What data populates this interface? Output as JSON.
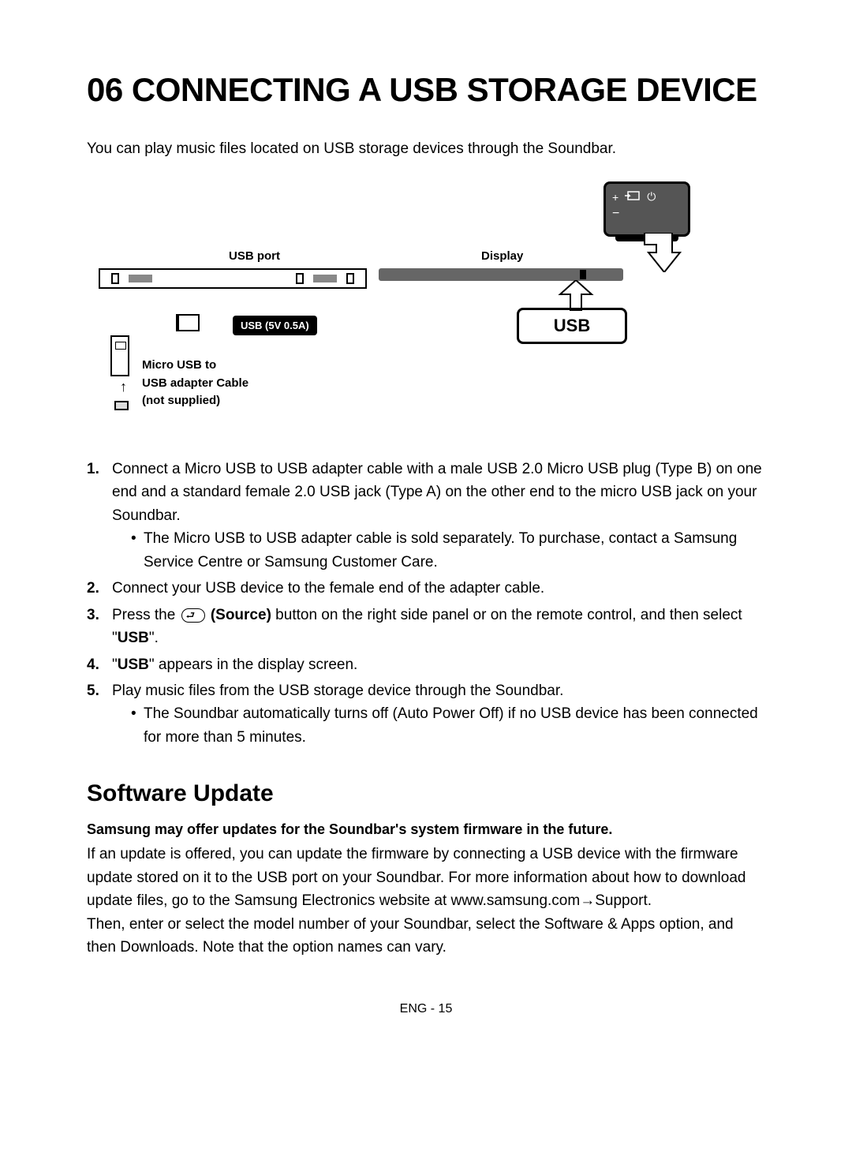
{
  "heading": "06 CONNECTING A USB STORAGE DEVICE",
  "intro": "You can play music files located on USB storage devices through the Soundbar.",
  "diagram": {
    "usb_port_label": "USB port",
    "usb_5v_label": "USB (5V 0.5A)",
    "adapter_line1": "Micro USB to",
    "adapter_line2": "USB adapter Cable",
    "adapter_line3": "(not supplied)",
    "display_label": "Display",
    "usb_box": "USB",
    "device_plus": "+",
    "device_minus": "−"
  },
  "steps": {
    "s1": "Connect a Micro USB to USB adapter cable with a male USB 2.0 Micro USB plug (Type B) on one end and a standard female 2.0 USB jack (Type A) on the other end to the micro USB jack on your Soundbar.",
    "s1_bullet": "The Micro USB to USB adapter cable is sold separately. To purchase, contact a Samsung Service Centre or Samsung Customer Care.",
    "s2": "Connect your USB device to the female end of the adapter cable.",
    "s3_a": "Press the ",
    "s3_source": " (Source)",
    "s3_b": " button on the right side panel or on the remote control, and then select \"",
    "s3_usb": "USB",
    "s3_c": "\".",
    "s4_a": "\"",
    "s4_usb": "USB",
    "s4_b": "\" appears in the display screen.",
    "s5": "Play music files from the USB storage device through the Soundbar.",
    "s5_bullet": "The Soundbar automatically turns off (Auto Power Off) if no USB device has been connected for more than 5 minutes."
  },
  "software": {
    "heading": "Software Update",
    "note": "Samsung may offer updates for the Soundbar's system firmware in the future.",
    "para1": "If an update is offered, you can update the firmware by connecting a USB device with the firmware update stored on it to the USB port on your Soundbar. For more information about how to download update files, go to the Samsung Electronics website at www.samsung.com→Support.",
    "para2": "Then, enter or select the model number of your Soundbar, select the Software & Apps option, and then Downloads. Note that the option names can vary."
  },
  "footer": "ENG - 15"
}
